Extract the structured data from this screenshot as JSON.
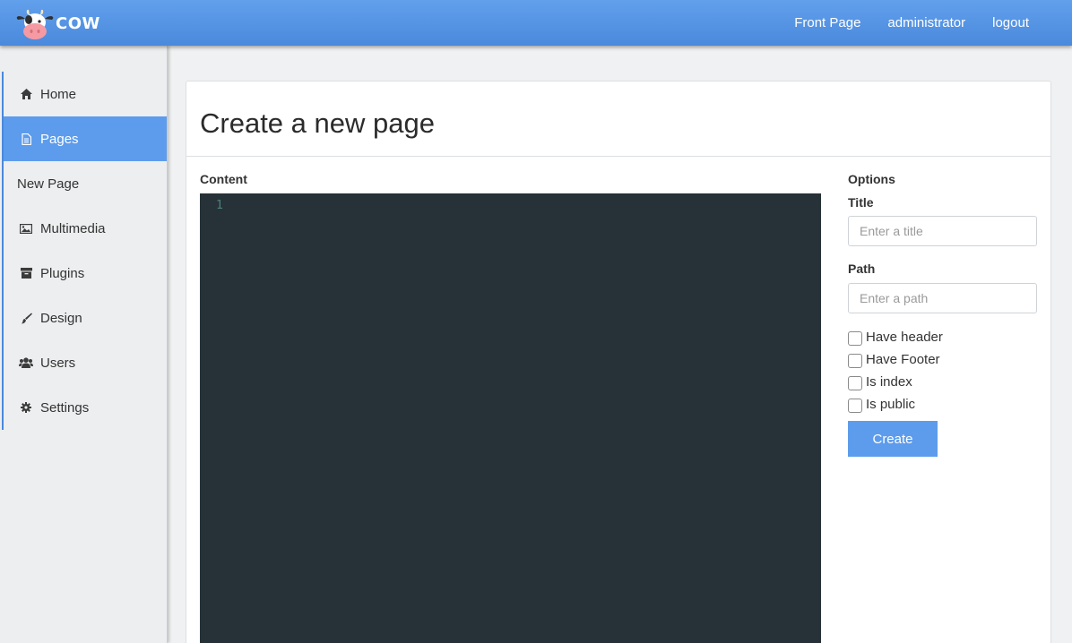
{
  "header": {
    "logo_text": "COW",
    "nav": [
      "Front Page",
      "administrator",
      "logout"
    ],
    "accent": "#4a89dc"
  },
  "sidebar": {
    "items": [
      {
        "label": "Home",
        "icon": "home-icon"
      },
      {
        "label": "Pages",
        "icon": "file-icon",
        "active": true
      },
      {
        "label": "New Page",
        "icon": null
      },
      {
        "label": "Multimedia",
        "icon": "image-icon"
      },
      {
        "label": "Plugins",
        "icon": "archive-icon"
      },
      {
        "label": "Design",
        "icon": "brush-icon"
      },
      {
        "label": "Users",
        "icon": "users-icon"
      },
      {
        "label": "Settings",
        "icon": "gear-icon"
      }
    ],
    "active_color": "#5d9cec"
  },
  "main": {
    "title": "Create a new page",
    "content_label": "Content",
    "editor": {
      "line_numbers": [
        "1"
      ],
      "background": "#263238"
    },
    "options": {
      "heading": "Options",
      "title_label": "Title",
      "title_placeholder": "Enter a title",
      "path_label": "Path",
      "path_placeholder": "Enter a path",
      "checkboxes": [
        {
          "label": "Have header",
          "checked": false
        },
        {
          "label": "Have Footer",
          "checked": false
        },
        {
          "label": "Is index",
          "checked": false
        },
        {
          "label": "Is public",
          "checked": false
        }
      ],
      "create_label": "Create"
    }
  }
}
